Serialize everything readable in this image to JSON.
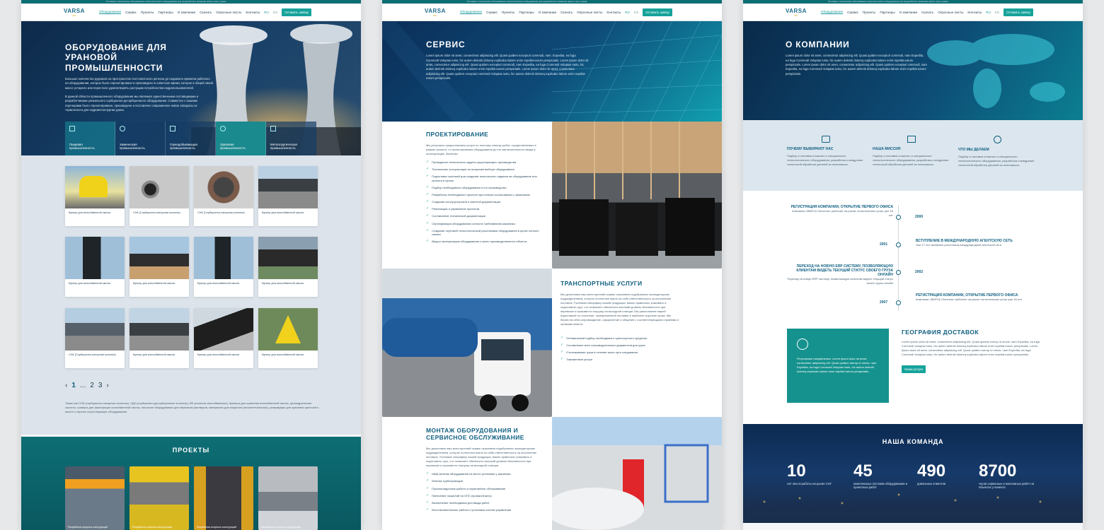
{
  "top_strip": "Поставка и техническое обслуживание технологического оборудования для переработки и хранения нефти, газа и урана",
  "nav": {
    "logo": "VARSA",
    "logo_sub": "EIC",
    "items": [
      "Оборудование",
      "Сервис",
      "Проекты",
      "Партнеры",
      "О компании",
      "Скачать",
      "Опросные листы",
      "Контакты"
    ],
    "lang_ru": "RU",
    "lang_en": "EN",
    "cta": "Оставить заявку"
  },
  "p1": {
    "hero_title": "Оборудование для урановой промышленности",
    "hero_p1": "Большое количество рудников на пространстве постсоветского региона до недавнего времени работало на оборудовании, которое было спроектировано и произведено в советское время, которое в общей своей массе устарело или перестало удовлетворять растущим потребностям недропользователей.",
    "hero_p2": "В данной области промышленного оборудования мы являемся единственными поставщиками и разработчиками уникального сорбционно-десорбционного оборудования. Совместно с нашими партнерами было спроектировано, произведено и поставлено современное новое аппараты из термопласта для гидрометаллургии урана.",
    "categories": [
      {
        "l1": "Пищевая",
        "l2": "промышленность"
      },
      {
        "l1": "Химическая",
        "l2": "промышленность"
      },
      {
        "l1": "Горнодобывающая",
        "l2": "промышленность"
      },
      {
        "l1": "Урановая",
        "l2": "промышленность"
      },
      {
        "l1": "Металлургическая",
        "l2": "промышленность"
      }
    ],
    "products": [
      "Бункер для ионообменной смолы",
      "СНК (Сорбционно-напорная колонна)",
      "СНК (Сорбционно-напорная колонна)",
      "Бункер для ионообменной смолы",
      "Бункер для ионообменной смолы",
      "Бункер для ионообменной смолы",
      "Бункер для ионообменной смолы",
      "Бункер для ионообменной смолы",
      "СНК (Сорбционно-напорная колонна)",
      "Бункер для ионообменной смолы",
      "Бункер для ионообменной смолы",
      "Бункер для ионообменной смолы"
    ],
    "pag_prev": "‹",
    "pag_1": "1",
    "pag_dots": "...",
    "pag_2": "2",
    "pag_3": "3",
    "pag_next": "›",
    "bottom_text": "Также как СНК (сорбционно-напорные колонны), СДК (сорбционно-десорбционные колонны), КФ (колонны ионообменные), бункеры для хранения ионообменной смолы, цилиндрические кассеты, гроверы для фильтрации ионообменной смолы, насосное оборудование для перекачки растворов, материалы для покрытия (геосинтетические), резервуары для хранения щелочей и кислот и прочие сопутствующее оборудование.",
    "projects_title": "Проекты",
    "project_captions": [
      "Разработка опорных конструкций",
      "Разработка опорных конструкций",
      "Разработка опорных конструкций",
      "Разработка опорных конструкций"
    ]
  },
  "p2": {
    "hero_title": "Сервис",
    "hero_text": "Lorem ipsum dolor sit amet, consectetur adipisicing elit. Quasi quidem excepturi commodi, nam. Expedita, ea fuga Commodi Voluptas iusto, hic autem deleniti doloreq explicabo labore enim repellat earum perspiciatis. Lorem ipsum dolor sit amet, consectetur adipisicing elit. Quasi quidem excepturi commodi, nam Expedita, ea fuga Commodi Voluptas iusto, hic autem deleniti doloreq explicabo labore enim repellat earum perspiciatis. Lorem ipsum dolor sit amet, consectetur adipisicing elit. Quasi quidem excepturi commodi Voluptas iusto, hic autem deleniti doloreq explicabo labore enim repellat earum perspiciatis.",
    "design_title": "Проектирование",
    "design_intro": "Мы регулярно предоставляем услуги по полному спектру работ, осуществляемых в рамках проекта, от проектирования оборудования до его заключительного ввода в эксплуатацию. Включая:",
    "design_list": [
      "Проведение технического аудита существующего производства",
      "Технические консультации по вопросам выбора оборудования",
      "Подготовка чертежей для создания технического задания на оборудование или проекта в целом",
      "Подбор необходимого оборудования и его производство",
      "Разработка необходимого проекта при полном согласовании с заказчиком",
      "Создание конструкторской и сметной документации",
      "Реализация и управление проектом",
      "Составление технической документации",
      "Сертификация оборудования согласно требованиям заказчика",
      "Создание чертежей технологической расстановки оборудования в целях полного охвата",
      "Ввод в эксплуатацию оборудования и всего производственного объекта"
    ],
    "transport_title": "Транспортные услуги",
    "transport_text": "Мы дополняем наш всесторонний сервис оказанием подобранных экспедиторских подразделением, которое полностью взяло на себя ответственность за исполнение поставок. Учитывая специфику нашей продукции, важно правильно упаковать и подготовить груз, что позволяет обеспечить высокий уровень безопасности при перевозке и произвести погрузку на выходной станции. Мы располагаем нашей подготовкой по логистике, своевременной поставке в наиболее короткие сроки. Мы берем на себя сопровождение, оформление и общение с соответствующими службами и органами власти.",
    "transport_list": [
      "Оптимальный подбор необходимого транспортного средства",
      "Составление всех сопроводительных документов для груза",
      "Отслеживание груза в течение всего пути следования",
      "Таможенные услуги"
    ],
    "install_title": "Монтаж оборудования и сервисное обслуживание",
    "install_text": "Мы дополняем наш всесторонний сервис оказанием подобранных экспедиторских подразделением, которое полностью взяло на себя ответственность за исполнение поставок. Учитывая специфику нашей продукции, важно правильно упаковать и подготовить груз, что позволяет обеспечить высокий уровень безопасности при перевозке и произвести погрузку на выходной станции.",
    "install_list": [
      "Шеф-монтаж оборудования на месте установки у заказчика",
      "Монтаж трубопроводов",
      "Пусконаладочные работы и гарантийное обслуживание",
      "Нанесение покрытий на ОПС (промконтакты)",
      "Выполнение необходимых для ввода работ",
      "Восстановительные работы и установка систем управления"
    ]
  },
  "p3": {
    "hero_title": "О компании",
    "hero_text": "Lorem ipsum dolor sit amet, consectetur adipisicing elit. Quasi quidem excepturi commodi, nam Expedita, ea fuga Commodi Voluptas iusto, hic autem deleniti doloreq explicabo labore enim repellat earum perspiciatis. Lorem ipsum dolor sit amet, consectetur adipisicing elit. Quasi quidem excepturi commodi, nam Expedita, ea fuga Commodi Voluptas iusto, hic autem deleniti doloreq explicabo labore enim repellat earum perspiciatis.",
    "features": [
      {
        "title": "Почему выбирают нас",
        "text": "Подбор и поставка сложного и специального технологического оборудования, разработка и внедрение технологий обработки деталей из пластмассы."
      },
      {
        "title": "Наша миссия",
        "text": "Подбор и поставка сложного и специального технологического оборудования, разработка и внедрение технологий обработки деталей из пластмассы."
      },
      {
        "title": "Что мы делаем",
        "text": "Подбор и поставка сложного и специального технологического оборудования, разработка и внедрение технологий обработки деталей из пластмассы."
      }
    ],
    "timeline": [
      {
        "title": "Регистрация компании, открытие первого офиса",
        "text": "Компания «ВАРСА Логистик» работает на рынке логистических услуг уже 18 лет",
        "year": "2000",
        "side": "left"
      },
      {
        "title": "Вступление в международную агентскую сеть",
        "text": "Уже 17 лет являемся участником международной агентской сети",
        "year": "2001",
        "side": "right"
      },
      {
        "title": "Переход на новую ERP систему, позволяющую клиентам видеть текущий статус своего груза онлайн",
        "text": "Переход на новую ERP систему, позволяющую клиентам видеть текущий статус своего груза онлайн",
        "year": "2002",
        "side": "left"
      },
      {
        "title": "Регистрация компании, открытие первого офиса",
        "text": "Компания «ВАРСА Логистик» работает на рынке логистических услуг уже 18 лет",
        "year": "2007",
        "side": "right"
      }
    ],
    "geo_box_text": "Регулярные направления: Lorem ipsum dolor sit amet, consectetur adipisicing elit. Quasi quidem earrup id omnis, nam Expedita, ea fuga Commodi Voluptas iusto, hic autem deleniti doloreq explicabo labore enim repellat earum perspiciatis.",
    "geo_title": "География доставок",
    "geo_text": "Lorem ipsum dolor sit amet, consectetur adipisicing elit. Quasi quidem earrup id omnis, nam Expedita, ea fuga Commodi Voluptas iusto, hic autem deleniti doloreq explicabo labore enim repellat earum perspiciatis. Lorem ipsum dolor sit amet, consectetur adipisicing elit. Quasi quidem earrup id omnis, nam Expedita, ea fuga Commodi Voluptas iusto, hic autem deleniti doloreq explicabo labore enim repellat earum perspiciatis.",
    "geo_btn": "Наши услуги",
    "team_title": "Наша команда",
    "stats": [
      {
        "n": "10",
        "t": "лет опыта работы на рынке СНГ"
      },
      {
        "n": "45",
        "t": "комплексных поставок оборудования и проектных работ"
      },
      {
        "n": "490",
        "t": "довольных клиентов"
      },
      {
        "n": "8700",
        "t": "часов сервисных и монтажных работ на объектах у клиента"
      }
    ]
  },
  "colors": {
    "accent": "#16a39a",
    "primary": "#0f5f80",
    "dark": "#0b2a4a"
  }
}
